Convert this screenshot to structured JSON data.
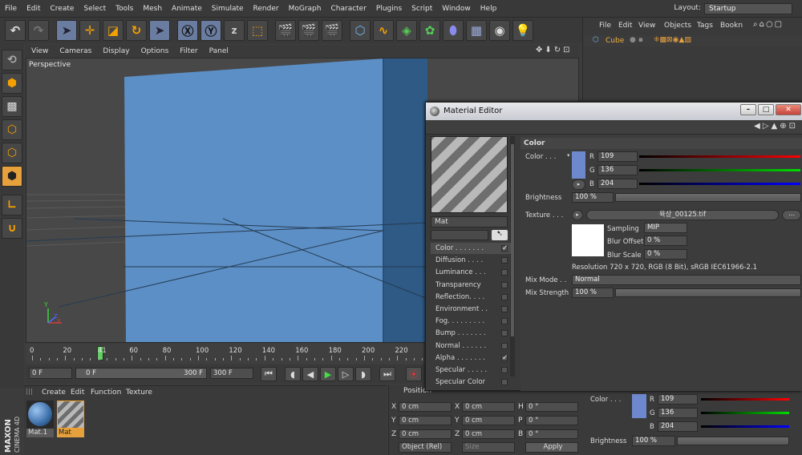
{
  "menubar": {
    "items": [
      "File",
      "Edit",
      "Create",
      "Select",
      "Tools",
      "Mesh",
      "Animate",
      "Simulate",
      "Render",
      "MoGraph",
      "Character",
      "Plugins",
      "Script",
      "Window",
      "Help"
    ],
    "layout_label": "Layout:",
    "layout_value": "Startup"
  },
  "viewport": {
    "menu": [
      "View",
      "Cameras",
      "Display",
      "Options",
      "Filter",
      "Panel"
    ],
    "label": "Perspective",
    "axis_y": "Y",
    "axis_x": "X",
    "axis_z": "Z"
  },
  "timeline": {
    "ticks": [
      "0",
      "20",
      "41",
      "60",
      "80",
      "100",
      "120",
      "140",
      "160",
      "180",
      "200",
      "220"
    ],
    "current_frame": 41,
    "start_field": "0 F",
    "range_start": "0 F",
    "range_end": "300 F",
    "end_field": "300 F"
  },
  "material_manager": {
    "menu": [
      "Create",
      "Edit",
      "Function",
      "Texture"
    ],
    "materials": [
      {
        "name": "Mat.1",
        "selected": false
      },
      {
        "name": "Mat",
        "selected": true
      }
    ]
  },
  "brand": {
    "line1": "MAXON",
    "line2": "CINEMA 4D"
  },
  "coordinates": {
    "header": "Position",
    "rows": [
      {
        "axis": "X",
        "pos": "0 cm",
        "size_axis": "X",
        "size": "0 cm",
        "rot_axis": "H",
        "rot": "0 °"
      },
      {
        "axis": "Y",
        "pos": "0 cm",
        "size_axis": "Y",
        "size": "0 cm",
        "rot_axis": "P",
        "rot": "0 °"
      },
      {
        "axis": "Z",
        "pos": "0 cm",
        "size_axis": "Z",
        "size": "0 cm",
        "rot_axis": "B",
        "rot": "0 °"
      }
    ],
    "mode_select": "Object (Rel)",
    "size_select": "Size",
    "apply_label": "Apply"
  },
  "object_manager": {
    "menu": [
      "File",
      "Edit",
      "View",
      "Objects",
      "Tags",
      "Bookn"
    ],
    "object_name": "Cube"
  },
  "attributes_bottom": {
    "color_label": "Color . . .",
    "r": "109",
    "g": "136",
    "b": "204",
    "brightness_label": "Brightness",
    "brightness": "100 %"
  },
  "material_editor": {
    "title": "Material Editor",
    "material_name": "Mat",
    "channels": [
      {
        "label": "Color . . . . . . .",
        "checked": true
      },
      {
        "label": "Diffusion . . . .",
        "checked": false
      },
      {
        "label": "Luminance . . .",
        "checked": false
      },
      {
        "label": "Transparency",
        "checked": false
      },
      {
        "label": "Reflection. . . .",
        "checked": false
      },
      {
        "label": "Environment . .",
        "checked": false
      },
      {
        "label": "Fog. . . . . . . . .",
        "checked": false
      },
      {
        "label": "Bump . . . . . . .",
        "checked": false
      },
      {
        "label": "Normal . . . . . .",
        "checked": false
      },
      {
        "label": "Alpha . . . . . . .",
        "checked": true
      },
      {
        "label": "Specular . . . . .",
        "checked": false
      },
      {
        "label": "Specular Color",
        "checked": false
      }
    ],
    "section_title": "Color",
    "color_label": "Color . . .",
    "color_hex": "#6d88cc",
    "r_label": "R",
    "r": "109",
    "g_label": "G",
    "g": "136",
    "b_label": "B",
    "b": "204",
    "brightness_label": "Brightness",
    "brightness": "100 %",
    "texture_label": "Texture . . .",
    "texture_file": "육상_00125.tif",
    "texture_more": "...",
    "sampling_label": "Sampling",
    "sampling": "MIP",
    "blur_offset_label": "Blur Offset",
    "blur_offset": "0 %",
    "blur_scale_label": "Blur Scale",
    "blur_scale": "0 %",
    "resolution": "Resolution 720 x 720, RGB (8 Bit), sRGB IEC61966-2.1",
    "mix_mode_label": "Mix Mode . .",
    "mix_mode": "Normal",
    "mix_strength_label": "Mix Strength",
    "mix_strength": "100 %"
  },
  "colors": {
    "cube_front": "#5b8fc6",
    "cube_side": "#2f5a85",
    "accent_orange": "#e6a13c",
    "playhead": "#5fd15f"
  }
}
